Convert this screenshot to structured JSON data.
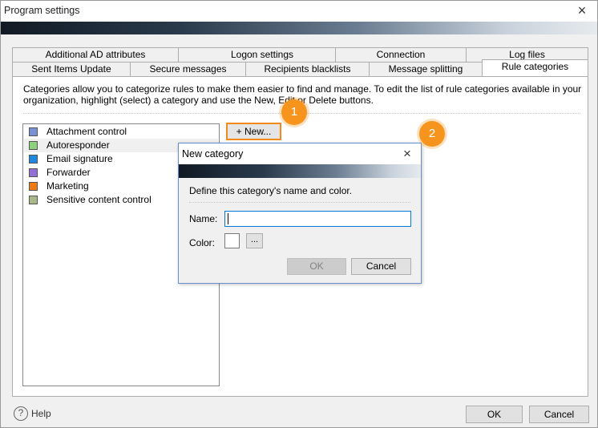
{
  "window": {
    "title": "Program settings",
    "close": "×"
  },
  "tabs_row1": [
    "Additional AD attributes",
    "Logon settings",
    "Connection",
    "Log files"
  ],
  "tabs_row2": [
    "Sent Items Update",
    "Secure messages",
    "Recipients blacklists",
    "Message splitting",
    "Rule categories"
  ],
  "active_tab": "Rule categories",
  "description": "Categories allow you to categorize rules to make them easier to find and manage. To edit the list of rule categories available in your organization, highlight (select) a category and use the New, Edit or Delete buttons.",
  "categories": [
    {
      "name": "Attachment control",
      "color": "#7a90d4"
    },
    {
      "name": "Autoresponder",
      "color": "#8fd07e",
      "selected": true
    },
    {
      "name": "Email signature",
      "color": "#1f87e0"
    },
    {
      "name": "Forwarder",
      "color": "#9370d6"
    },
    {
      "name": "Marketing",
      "color": "#f07a16"
    },
    {
      "name": "Sensitive content control",
      "color": "#a9b88a"
    }
  ],
  "new_button": "+ New...",
  "callouts": [
    "1",
    "2"
  ],
  "dialog": {
    "title": "New category",
    "close": "×",
    "instruction": "Define this category's name and color.",
    "name_label": "Name:",
    "name_value": "",
    "color_label": "Color:",
    "color_value": "#ffffff",
    "browse_label": "...",
    "ok_label": "OK",
    "cancel_label": "Cancel"
  },
  "footer": {
    "help_icon": "?",
    "help_label": "Help",
    "ok_label": "OK",
    "cancel_label": "Cancel"
  },
  "colors": {
    "accent": "#f7941d",
    "focus": "#0078d7"
  }
}
